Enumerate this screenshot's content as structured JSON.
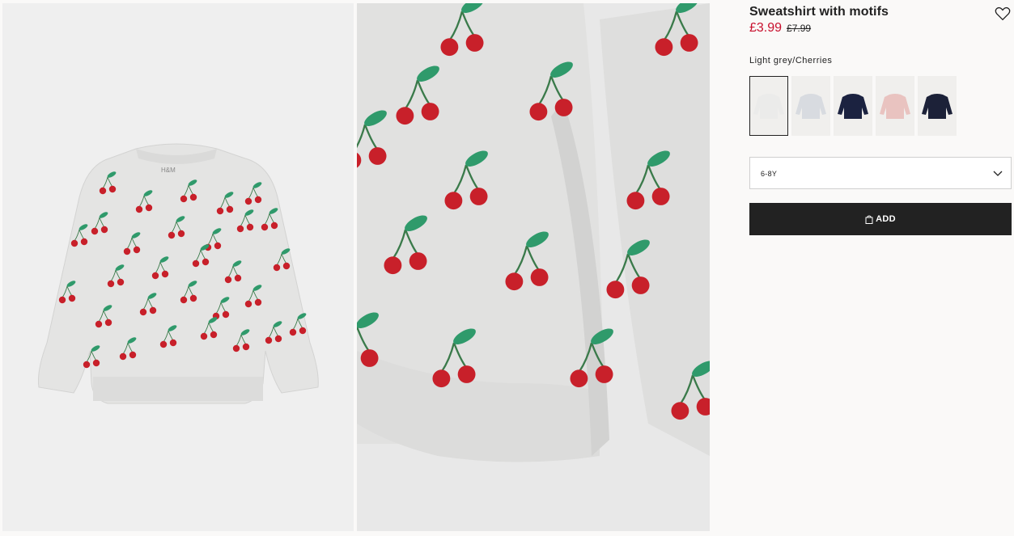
{
  "product": {
    "title": "Sweatshirt with motifs",
    "price_now": "£3.99",
    "price_old": "£7.99",
    "color_name": "Light grey/Cherries"
  },
  "swatches": [
    {
      "name": "light-grey-cherries",
      "selected": true,
      "color": "#ebebea"
    },
    {
      "name": "grey-motif",
      "selected": false,
      "color": "#d8dbe0"
    },
    {
      "name": "navy-motif",
      "selected": false,
      "color": "#1b2240"
    },
    {
      "name": "pink",
      "selected": false,
      "color": "#e9c3c0"
    },
    {
      "name": "dark-navy-stars",
      "selected": false,
      "color": "#1c2138"
    }
  ],
  "size": {
    "selected": "6-8Y"
  },
  "add": {
    "label": "ADD"
  },
  "brand_tag": "H&M",
  "colors": {
    "sale": "#c8102e",
    "button": "#222222",
    "cherry": "#c8202a",
    "leaf": "#2f9a6b"
  },
  "icons": [
    "heart-icon",
    "chevron-down-icon",
    "shopping-bag-icon"
  ]
}
